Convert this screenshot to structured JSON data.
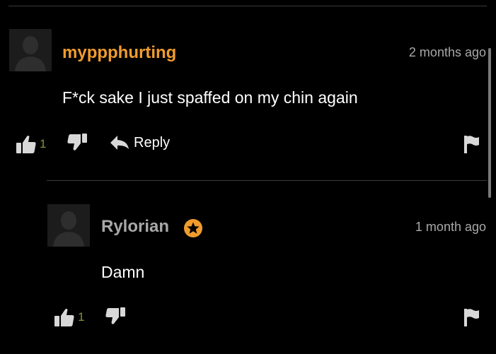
{
  "colors": {
    "background": "#000000",
    "username_primary": "#f09c2e",
    "username_secondary": "#a8a8a8",
    "timestamp": "#a8a8a8",
    "vote_count": "#8b8f3a",
    "icon": "#d8d8d8",
    "divider": "#3a3a3a",
    "badge": "#f09c2e"
  },
  "comments": [
    {
      "username": "myppphurting",
      "timestamp": "2 months ago",
      "text": "F*ck sake I just spaffed on my chin again",
      "upvotes": "1",
      "reply_label": "Reply",
      "icons": [
        "avatar-placeholder-icon",
        "thumbs-up-icon",
        "thumbs-down-icon",
        "reply-arrow-icon",
        "flag-icon"
      ]
    },
    {
      "username": "Rylorian",
      "timestamp": "1 month ago",
      "text": "Damn",
      "upvotes": "1",
      "badge": "star-badge-icon",
      "icons": [
        "avatar-placeholder-icon",
        "thumbs-up-icon",
        "thumbs-down-icon",
        "flag-icon"
      ]
    }
  ]
}
